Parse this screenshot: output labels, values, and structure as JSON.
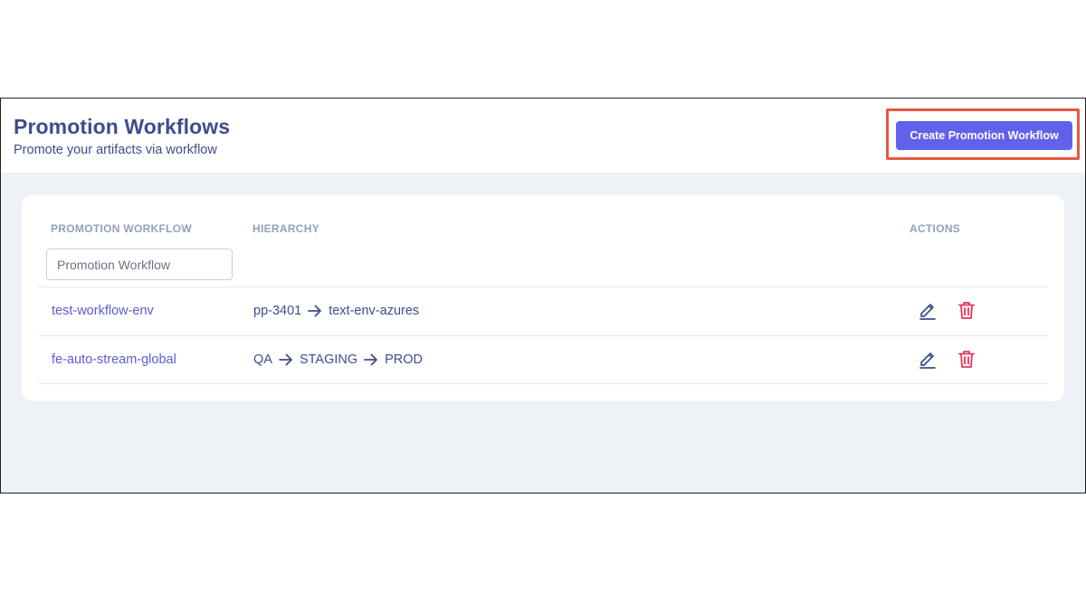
{
  "header": {
    "title": "Promotion Workflows",
    "subtitle": "Promote your artifacts via workflow",
    "create_button_label": "Create Promotion Workflow"
  },
  "table": {
    "columns": {
      "workflow": "PROMOTION WORKFLOW",
      "hierarchy": "HIERARCHY",
      "actions": "ACTIONS"
    },
    "filter_placeholder": "Promotion Workflow",
    "rows": [
      {
        "name": "test-workflow-env",
        "hierarchy": [
          "pp-3401",
          "text-env-azures"
        ]
      },
      {
        "name": "fe-auto-stream-global",
        "hierarchy": [
          "QA",
          "STAGING",
          "PROD"
        ]
      }
    ]
  },
  "icons": {
    "edit": "pencil-icon",
    "delete": "trash-icon",
    "arrow": "arrow-right-icon"
  },
  "colors": {
    "accent": "#6161ec",
    "title": "#3f4c8c",
    "link": "#5b5bd6",
    "delete": "#e8335d",
    "highlight": "#e8573f",
    "content_bg": "#eef1f5"
  }
}
